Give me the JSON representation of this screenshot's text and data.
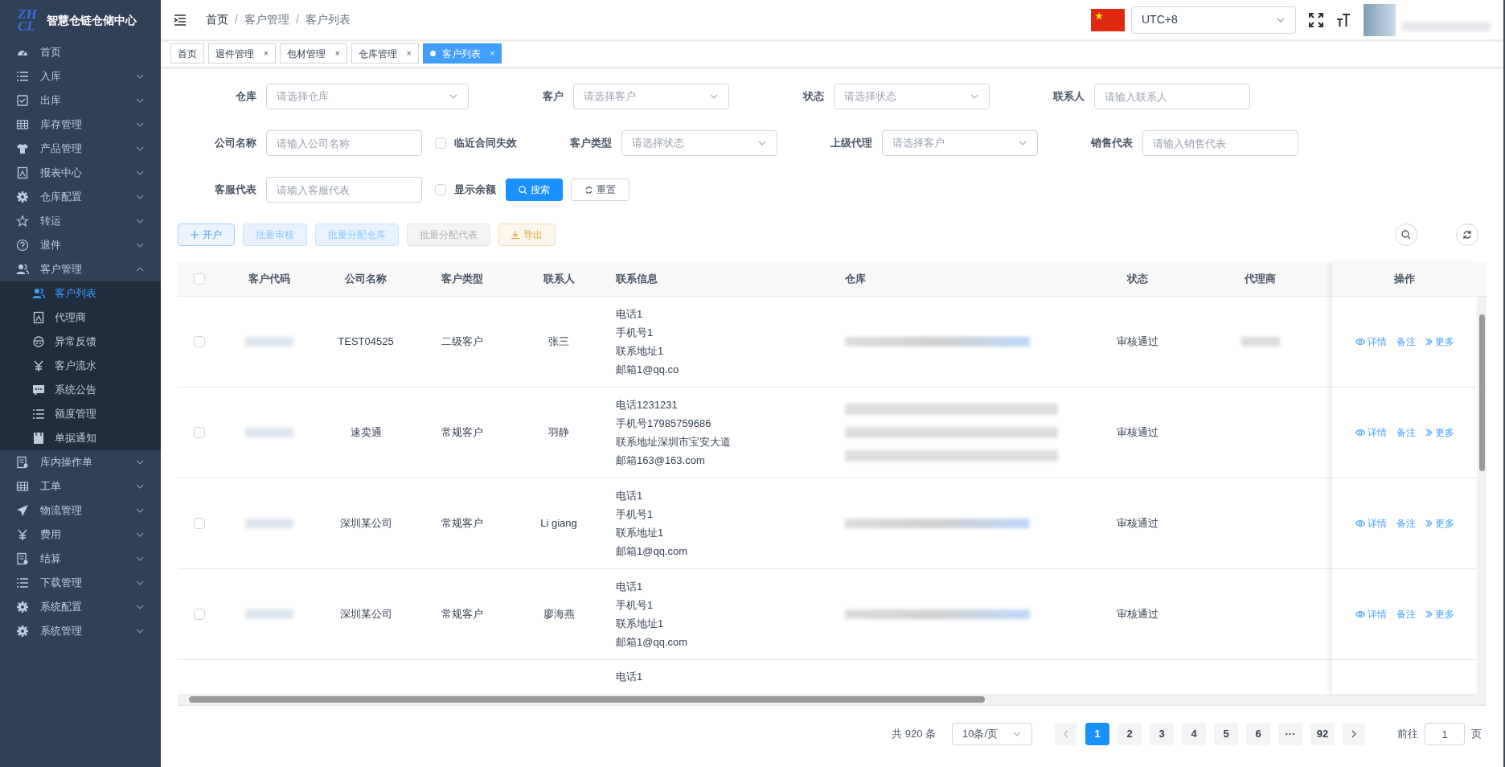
{
  "sidebar": {
    "logo_letters": [
      "ZH",
      "CL"
    ],
    "title": "智慧仓链仓储中心",
    "items": [
      {
        "label": "首页",
        "expandable": false
      },
      {
        "label": "入库",
        "expandable": true,
        "expanded": false
      },
      {
        "label": "出库",
        "expandable": true,
        "expanded": false
      },
      {
        "label": "库存管理",
        "expandable": true,
        "expanded": false
      },
      {
        "label": "产品管理",
        "expandable": true,
        "expanded": false
      },
      {
        "label": "报表中心",
        "expandable": true,
        "expanded": false
      },
      {
        "label": "仓库配置",
        "expandable": true,
        "expanded": false
      },
      {
        "label": "转运",
        "expandable": true,
        "expanded": false
      },
      {
        "label": "退件",
        "expandable": true,
        "expanded": false
      },
      {
        "label": "客户管理",
        "expandable": true,
        "expanded": true,
        "children": [
          {
            "label": "客户列表",
            "selected": true
          },
          {
            "label": "代理商",
            "selected": false
          },
          {
            "label": "异常反馈",
            "selected": false
          },
          {
            "label": "客户流水",
            "selected": false
          },
          {
            "label": "系统公告",
            "selected": false
          },
          {
            "label": "额度管理",
            "selected": false
          },
          {
            "label": "单据通知",
            "selected": false
          }
        ]
      },
      {
        "label": "库内操作单",
        "expandable": true,
        "expanded": false
      },
      {
        "label": "工单",
        "expandable": true,
        "expanded": false
      },
      {
        "label": "物流管理",
        "expandable": true,
        "expanded": false
      },
      {
        "label": "费用",
        "expandable": true,
        "expanded": false
      },
      {
        "label": "结算",
        "expandable": true,
        "expanded": false
      },
      {
        "label": "下载管理",
        "expandable": true,
        "expanded": false
      },
      {
        "label": "系统配置",
        "expandable": true,
        "expanded": false
      },
      {
        "label": "系统管理",
        "expandable": true,
        "expanded": false
      }
    ]
  },
  "breadcrumb": [
    "首页",
    "客户管理",
    "客户列表"
  ],
  "breadcrumb_separator": "/",
  "header": {
    "timezone": "UTC+8"
  },
  "tags": [
    {
      "label": "首页",
      "closable": false,
      "selected": false
    },
    {
      "label": "退件管理",
      "closable": true,
      "close": "×",
      "selected": false
    },
    {
      "label": "包材管理",
      "closable": true,
      "close": "×",
      "selected": false
    },
    {
      "label": "仓库管理",
      "closable": true,
      "close": "×",
      "selected": false
    },
    {
      "label": "客户列表",
      "closable": true,
      "close": "×",
      "selected": true
    }
  ],
  "filters": [
    [
      {
        "kind": "select",
        "label": "仓库",
        "placeholder": "请选择仓库"
      },
      {
        "kind": "select",
        "label": "客户",
        "placeholder": "请选择客户"
      },
      {
        "kind": "select",
        "label": "状态",
        "placeholder": "请选择状态"
      },
      {
        "kind": "input",
        "label": "联系人",
        "placeholder": "请输入联系人"
      }
    ],
    [
      {
        "kind": "input",
        "label": "公司名称",
        "placeholder": "请输入公司名称"
      },
      {
        "kind": "checkbox",
        "label": "临近合同失效",
        "checked": false
      },
      {
        "kind": "select",
        "label": "客户类型",
        "placeholder": "请选择状态"
      },
      {
        "kind": "select",
        "label": "上级代理",
        "placeholder": "请选择客户"
      },
      {
        "kind": "input",
        "label": "销售代表",
        "placeholder": "请输入销售代表"
      }
    ],
    [
      {
        "kind": "input",
        "label": "客服代表",
        "placeholder": "请输入客服代表"
      },
      {
        "kind": "checkbox",
        "label": "显示余额",
        "checked": false
      },
      {
        "kind": "search",
        "label": "搜索"
      },
      {
        "kind": "reset",
        "label": "重置"
      }
    ]
  ],
  "toolbar": [
    {
      "kind": "add",
      "label": "开户"
    },
    {
      "kind": "light",
      "label": "批量审核"
    },
    {
      "kind": "light",
      "label": "批量分配仓库"
    },
    {
      "kind": "disabled",
      "label": "批量分配代表"
    },
    {
      "kind": "export",
      "label": "导出"
    }
  ],
  "table": {
    "header_checked": false,
    "columns": [
      "客户代码",
      "公司名称",
      "客户类型",
      "联系人",
      "联系信息",
      "仓库",
      "状态",
      "代理商",
      "操作"
    ],
    "rows": [
      {
        "checked": false,
        "code_blurred": true,
        "company": "TEST04525",
        "type": "二级客户",
        "contact": "张三",
        "info": [
          "电话1",
          "手机号1",
          "联系地址1",
          "邮箱1@qq.co"
        ],
        "warehouse": {
          "kind": "single"
        },
        "status": "审核通过",
        "agent_blurred": true,
        "actions": [
          {
            "kind": "view",
            "label": "详情"
          },
          {
            "kind": "note",
            "label": "备注"
          },
          {
            "kind": "more",
            "label": "更多"
          }
        ]
      },
      {
        "checked": false,
        "code_blurred": true,
        "company": "速卖通",
        "type": "常规客户",
        "contact": "羽静",
        "info": [
          "电话1231231",
          "手机号17985759686",
          "联系地址深圳市宝安大道",
          "邮箱163@163.com"
        ],
        "warehouse": {
          "kind": "triple"
        },
        "status": "审核通过",
        "agent_blurred": false,
        "actions": [
          {
            "kind": "view",
            "label": "详情"
          },
          {
            "kind": "note",
            "label": "备注"
          },
          {
            "kind": "more",
            "label": "更多"
          }
        ]
      },
      {
        "checked": false,
        "code_blurred": true,
        "company": "深圳某公司",
        "type": "常规客户",
        "contact": "Li giang",
        "info": [
          "电话1",
          "手机号1",
          "联系地址1",
          "邮箱1@qq.com"
        ],
        "warehouse": {
          "kind": "single"
        },
        "status": "审核通过",
        "agent_blurred": false,
        "actions": [
          {
            "kind": "view",
            "label": "详情"
          },
          {
            "kind": "note",
            "label": "备注"
          },
          {
            "kind": "more",
            "label": "更多"
          }
        ]
      },
      {
        "checked": false,
        "code_blurred": true,
        "company": "深圳某公司",
        "type": "常规客户",
        "contact": "廖海燕",
        "info": [
          "电话1",
          "手机号1",
          "联系地址1",
          "邮箱1@qq.com"
        ],
        "warehouse": {
          "kind": "single"
        },
        "status": "审核通过",
        "agent_blurred": false,
        "actions": [
          {
            "kind": "view",
            "label": "详情"
          },
          {
            "kind": "note",
            "label": "备注"
          },
          {
            "kind": "more",
            "label": "更多"
          }
        ]
      },
      {
        "info": [
          "电话1"
        ]
      }
    ]
  },
  "pagination": {
    "total": "共 920 条",
    "page_size": "10条/页",
    "pages": [
      {
        "label": "1",
        "selected": true
      },
      {
        "label": "2",
        "selected": false
      },
      {
        "label": "3",
        "selected": false
      },
      {
        "label": "4",
        "selected": false
      },
      {
        "label": "5",
        "selected": false
      },
      {
        "label": "6",
        "selected": false
      },
      {
        "label": "···",
        "selected": false
      },
      {
        "label": "92",
        "selected": false
      }
    ],
    "goto_label": "前往",
    "goto_value": "1",
    "goto_suffix": "页"
  }
}
